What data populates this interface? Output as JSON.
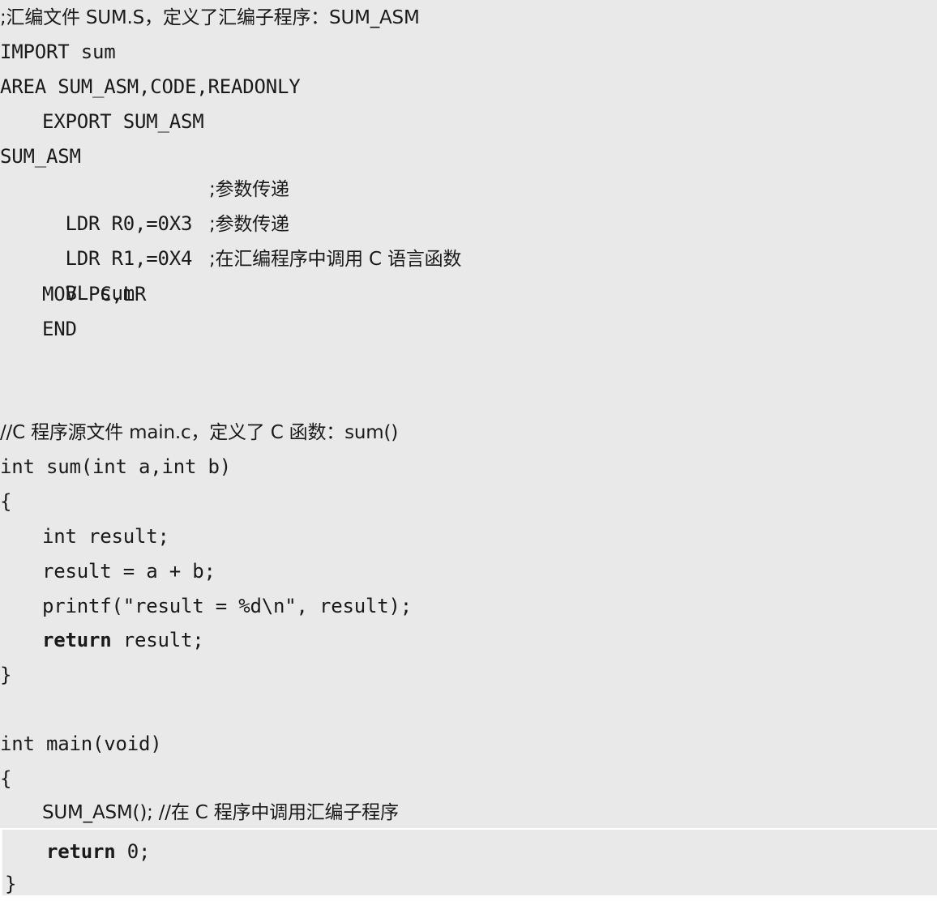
{
  "lines": {
    "l01": ";汇编文件 SUM.S，定义了汇编子程序：SUM_ASM",
    "l02": "IMPORT sum",
    "l03": "AREA SUM_ASM,CODE,READONLY",
    "l04": "EXPORT SUM_ASM",
    "l05": "SUM_ASM",
    "l06_code": "LDR R0,=0X3",
    "l06_comment": ";参数传递",
    "l07_code": "LDR R1,=0X4",
    "l07_comment": ";参数传递",
    "l08_code": "BL sum",
    "l08_comment": ";在汇编程序中调用 C 语言函数",
    "l09": "MOV PC,LR",
    "l10": "END",
    "l11": "//C 程序源文件 main.c，定义了 C 函数：sum()",
    "l12": "int sum(int a,int b)",
    "l13": "{",
    "l14": "int result;",
    "l15": "result = a + b;",
    "l16": "printf(\"result = %d\\n\", result);",
    "l17_kw": "return",
    "l17_rest": " result;",
    "l18": "}",
    "l19": "int main(void)",
    "l20": "{",
    "l21": "SUM_ASM(); //在 C 程序中调用汇编子程序",
    "l22_kw": "return",
    "l22_rest": " 0;",
    "l23": "}"
  }
}
